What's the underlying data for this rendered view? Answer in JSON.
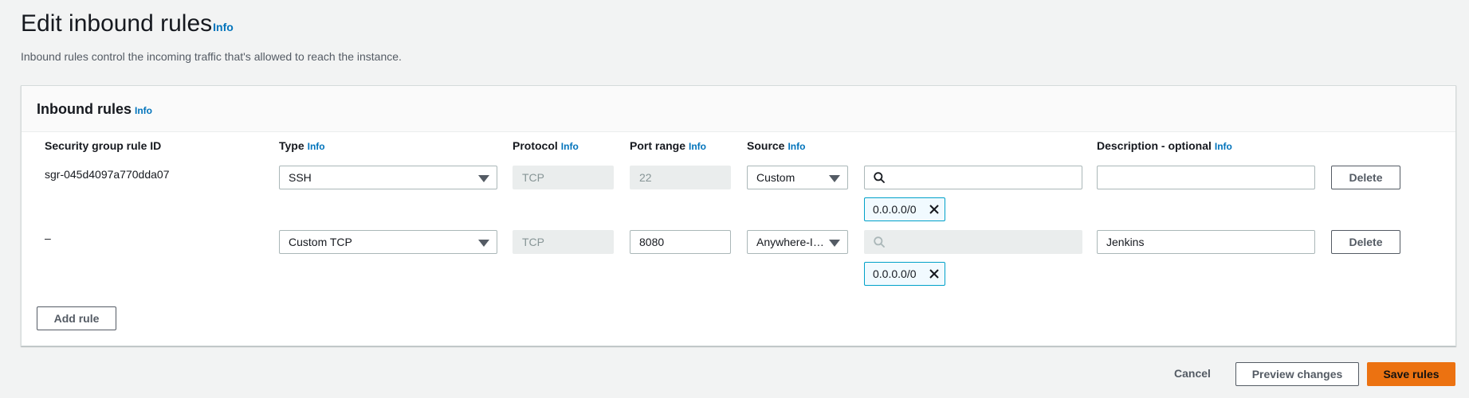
{
  "page": {
    "title": "Edit inbound rules",
    "title_info": "Info",
    "description": "Inbound rules control the incoming traffic that's allowed to reach the instance."
  },
  "panel": {
    "title": "Inbound rules",
    "info": "Info",
    "columns": {
      "rule_id": "Security group rule ID",
      "type": "Type",
      "protocol": "Protocol",
      "port_range": "Port range",
      "source": "Source",
      "description": "Description - optional",
      "info": "Info"
    },
    "rows": [
      {
        "rule_id": "sgr-045d4097a770dda07",
        "type": "SSH",
        "protocol": "TCP",
        "port_range": "22",
        "source_type": "Custom",
        "source_search": "",
        "cidr_token": "0.0.0.0/0",
        "description": "",
        "delete_label": "Delete"
      },
      {
        "rule_id": "–",
        "type": "Custom TCP",
        "protocol": "TCP",
        "port_range": "8080",
        "source_type": "Anywhere-IPv4",
        "source_search": "",
        "cidr_token": "0.0.0.0/0",
        "description": "Jenkins",
        "delete_label": "Delete"
      }
    ],
    "add_rule_label": "Add rule"
  },
  "footer": {
    "cancel_label": "Cancel",
    "preview_label": "Preview changes",
    "save_label": "Save rules"
  },
  "colors": {
    "link": "#0073bb",
    "primary": "#ec7211",
    "token_border": "#00a1c9"
  }
}
